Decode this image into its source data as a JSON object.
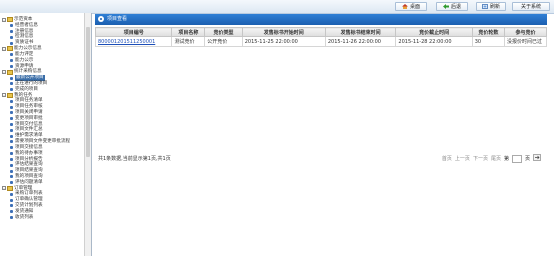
{
  "toolbar": {
    "home": "桌面",
    "back": "后退",
    "refresh": "刷新",
    "about": "关于系统"
  },
  "sidebar": {
    "items": [
      {
        "label": "示范资本",
        "level": 1,
        "expander": "-",
        "type": "folder"
      },
      {
        "label": "经营者信息",
        "level": 2,
        "type": "leaf"
      },
      {
        "label": "注册信息",
        "level": 2,
        "type": "leaf"
      },
      {
        "label": "检测信息",
        "level": 2,
        "type": "leaf"
      },
      {
        "label": "资质证书",
        "level": 2,
        "type": "leaf"
      },
      {
        "label": "能力公示信息",
        "level": 1,
        "expander": "-",
        "type": "folder"
      },
      {
        "label": "能力评定",
        "level": 2,
        "type": "leaf"
      },
      {
        "label": "能力公示",
        "level": 2,
        "type": "leaf"
      },
      {
        "label": "资源申请",
        "level": 2,
        "type": "leaf"
      },
      {
        "label": "统计采购信息",
        "level": 1,
        "expander": "-",
        "type": "folder"
      },
      {
        "label": "最新公开项目",
        "level": 2,
        "type": "leaf",
        "selected": true
      },
      {
        "label": "正在进行的项目",
        "level": 2,
        "type": "leaf"
      },
      {
        "label": "完成的项目",
        "level": 2,
        "type": "leaf"
      },
      {
        "label": "我的任务",
        "level": 1,
        "expander": "-",
        "type": "folder"
      },
      {
        "label": "项目任务清单",
        "level": 2,
        "type": "leaf"
      },
      {
        "label": "项目任务审核",
        "level": 2,
        "type": "leaf"
      },
      {
        "label": "项目关闭申请",
        "level": 2,
        "type": "leaf"
      },
      {
        "label": "变更项目审批",
        "level": 2,
        "type": "leaf"
      },
      {
        "label": "项目交付信息",
        "level": 2,
        "type": "leaf"
      },
      {
        "label": "项目文件汇总",
        "level": 2,
        "type": "leaf"
      },
      {
        "label": "维护需求清单",
        "level": 2,
        "type": "leaf"
      },
      {
        "label": "需要项目文件变更审批流程",
        "level": 2,
        "type": "leaf"
      },
      {
        "label": "项目交接信息",
        "level": 2,
        "type": "leaf"
      },
      {
        "label": "我的待办事项",
        "level": 2,
        "type": "leaf"
      },
      {
        "label": "项目分析报告",
        "level": 2,
        "type": "leaf"
      },
      {
        "label": "评估结果查询",
        "level": 2,
        "type": "leaf"
      },
      {
        "label": "项目结果查询",
        "level": 2,
        "type": "leaf"
      },
      {
        "label": "我的项目查询",
        "level": 2,
        "type": "leaf"
      },
      {
        "label": "评估问题清单",
        "level": 2,
        "type": "leaf"
      },
      {
        "label": "订单管理",
        "level": 1,
        "expander": "-",
        "type": "folder"
      },
      {
        "label": "采购订单列表",
        "level": 2,
        "type": "leaf"
      },
      {
        "label": "订单确认管理",
        "level": 2,
        "type": "leaf"
      },
      {
        "label": "交货计划列表",
        "level": 2,
        "type": "leaf"
      },
      {
        "label": "发货通知",
        "level": 2,
        "type": "leaf"
      },
      {
        "label": "收货列表",
        "level": 2,
        "type": "leaf"
      }
    ]
  },
  "panel": {
    "title": "项目查看"
  },
  "table": {
    "headers": [
      "项目编号",
      "项目名称",
      "竞价类型",
      "发售标书开始时间",
      "发售标书结束时间",
      "竞价截止时间",
      "竞价轮数",
      "参与竞价"
    ],
    "rows": [
      [
        "800001201511250001",
        "测试竞价",
        "公开竞价",
        "2015-11-25 22:00:00",
        "2015-11-26 22:00:00",
        "2015-11-28 22:00:00",
        "30",
        "没报价时间已过"
      ]
    ]
  },
  "footer": {
    "info": "共1条数据,当前显示第1页,共1页",
    "first": "首页",
    "prev": "上一页",
    "next": "下一页",
    "last": "尾页",
    "jump_prefix": "第",
    "jump_suffix": "页"
  },
  "colors": {
    "panel_header": "#1b5fb0",
    "link": "#1d4fb8",
    "selected": "#3b6ea8"
  }
}
